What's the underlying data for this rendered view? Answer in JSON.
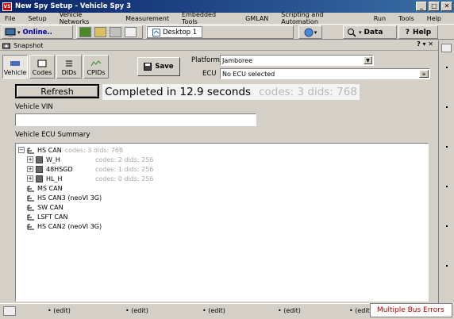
{
  "window": {
    "title": "New Spy Setup - Vehicle Spy 3",
    "app_icon_text": "VS",
    "controls": [
      "_",
      "□",
      "✕"
    ]
  },
  "menu": [
    "File",
    "Setup",
    "Vehicle Networks",
    "Measurement",
    "Embedded Tools",
    "GMLAN",
    "Scripting and Automation",
    "Run",
    "Tools",
    "Help"
  ],
  "toolbar": {
    "online_label": "Online..",
    "desktop_tab": "Desktop 1",
    "data_label": "Data",
    "help_label": "Help"
  },
  "panel": {
    "title": "Snapshot",
    "controls": "? ▾ ✕",
    "tabs": [
      {
        "label": "Vehicle"
      },
      {
        "label": "Codes"
      },
      {
        "label": "DIDs"
      },
      {
        "label": "CPIDs"
      }
    ],
    "save_label": "Save",
    "platform_label": "Platform",
    "platform_value": "Jamboree",
    "ecu_label": "ECU",
    "ecu_value": "No ECU selected"
  },
  "main": {
    "refresh_label": "Refresh",
    "status_text": "Completed in 12.9 seconds",
    "status_sub": "codes: 3 dids: 768",
    "vin_label": "Vehicle VIN",
    "vin_value": "",
    "summary_label": "Vehicle ECU Summary",
    "tree": [
      {
        "label": "HS CAN",
        "meta": "codes: 3 dids: 768"
      },
      {
        "label": "W_H",
        "meta": "codes: 2 dids: 256"
      },
      {
        "label": "48HSGD",
        "meta": "codes: 1 dids: 256"
      },
      {
        "label": "HL_H",
        "meta": "codes: 0 dids: 256"
      },
      {
        "label": "MS CAN",
        "meta": ""
      },
      {
        "label": "HS CAN3 (neoVI 3G)",
        "meta": ""
      },
      {
        "label": "SW CAN",
        "meta": ""
      },
      {
        "label": "LSFT CAN",
        "meta": ""
      },
      {
        "label": "HS CAN2 (neoVI 3G)",
        "meta": ""
      }
    ]
  },
  "statusbar": {
    "edit_label": "(edit)",
    "error_label": "Multiple Bus Errors"
  },
  "colors": {
    "title_gradient_start": "#0a246a",
    "title_gradient_end": "#3a6ea5",
    "error_text": "#c00000",
    "online_text": "#0000aa"
  }
}
